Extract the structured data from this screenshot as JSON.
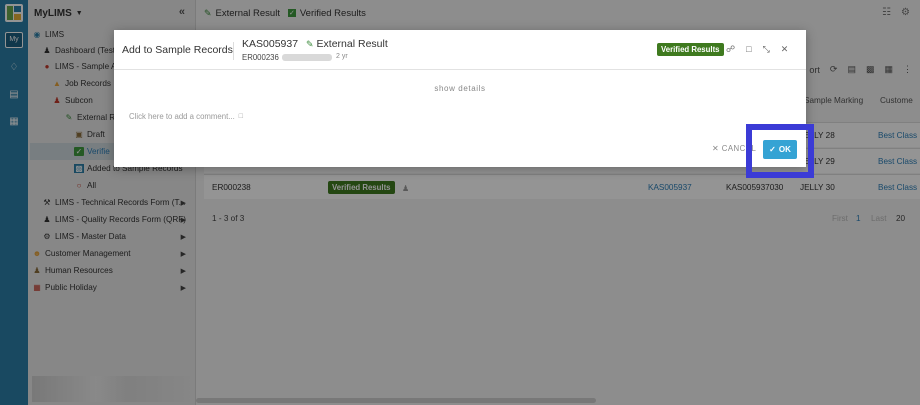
{
  "app": {
    "title": "MyLIMS",
    "my_badge": "My"
  },
  "header": {
    "breadcrumbs": [
      {
        "label": "External Result",
        "icon": "pencil-icon"
      },
      {
        "label": "Verified Results",
        "icon": "checkbox-icon"
      }
    ]
  },
  "sidebar": {
    "items": [
      {
        "label": "LIMS",
        "icon": "globe-icon"
      },
      {
        "label": "Dashboard (Testi",
        "icon": "user-icon"
      },
      {
        "label": "LIMS - Sample Ac",
        "icon": "flask-icon"
      },
      {
        "label": "Job Records",
        "icon": "warning-icon"
      },
      {
        "label": "Subcon",
        "icon": "person-icon"
      },
      {
        "label": "External Re",
        "icon": "pencil-icon"
      },
      {
        "label": "Draft",
        "icon": "draft-icon"
      },
      {
        "label": "Verifie",
        "icon": "checkbox-icon"
      },
      {
        "label": "Added to Sample Records",
        "icon": "records-icon"
      },
      {
        "label": "All",
        "icon": "circle-icon"
      },
      {
        "label": "LIMS - Technical Records Form (T...",
        "icon": "tools-icon"
      },
      {
        "label": "LIMS - Quality Records Form (QRF)",
        "icon": "user-icon"
      },
      {
        "label": "LIMS - Master Data",
        "icon": "gear-icon"
      },
      {
        "label": "Customer Management",
        "icon": "emoji-icon"
      },
      {
        "label": "Human Resources",
        "icon": "people-icon"
      },
      {
        "label": "Public Holiday",
        "icon": "calendar-icon"
      }
    ]
  },
  "table": {
    "headers": {
      "sample_marking": "Sample Marking",
      "customer": "Custome"
    },
    "toolbar_label": "ort",
    "rows": [
      {
        "id": "",
        "status": "",
        "job": "",
        "ref": "",
        "marking": "JELLY 28",
        "customer": "Best Class"
      },
      {
        "id": "",
        "status": "",
        "job": "",
        "ref": "",
        "marking": "JELLY 29",
        "customer": "Best Class"
      },
      {
        "id": "ER000238",
        "status": "Verified Results",
        "job": "KAS005937",
        "ref": "KAS005937030",
        "marking": "JELLY 30",
        "customer": "Best Class"
      }
    ],
    "pager": {
      "range": "1 - 3 of 3",
      "first": "First",
      "page": "1",
      "last": "Last",
      "size": "20"
    }
  },
  "modal": {
    "title": "Add to Sample Records",
    "record_id": "KAS005937",
    "record_kind": "External Result",
    "sub_id": "ER000236",
    "age": "2 yr",
    "status": "Verified Results",
    "show_details": "show details",
    "comment_placeholder": "Click here to add a comment...",
    "cancel_label": "CANCEL",
    "ok_label": "OK"
  },
  "colors": {
    "accent": "#35a3d4",
    "status_green": "#3f7a1f",
    "rail": "#2b7fa8",
    "highlight": "#3b3bd6"
  }
}
